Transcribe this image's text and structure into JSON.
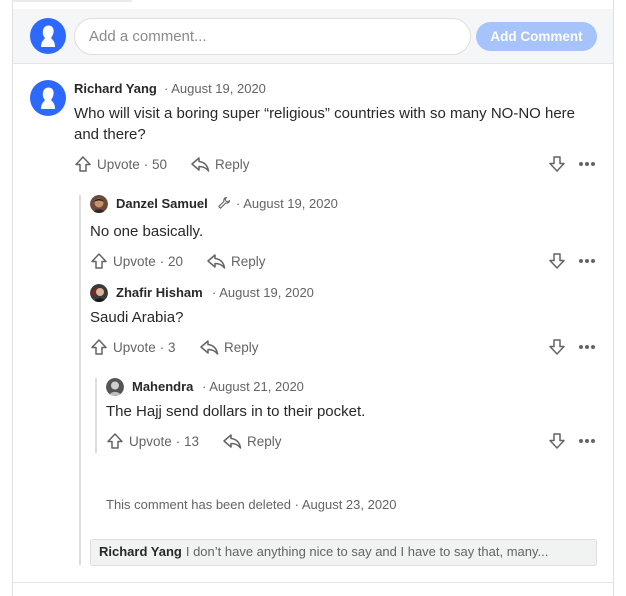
{
  "composer": {
    "placeholder": "Add a comment...",
    "button_label": "Add Comment"
  },
  "comments": [
    {
      "author": "Richard Yang",
      "date": "· August 19, 2020",
      "text": "Who will visit a boring super “religious” countries with so many NO-NO here and there?",
      "upvote_label": "Upvote",
      "upvotes": "· 50",
      "reply_label": "Reply"
    },
    {
      "author": "Danzel Samuel",
      "date": "· August 19, 2020",
      "text": "No one basically.",
      "upvote_label": "Upvote",
      "upvotes": "· 20",
      "reply_label": "Reply"
    },
    {
      "author": "Zhafir Hisham",
      "date": "· August 19, 2020",
      "text": "Saudi Arabia?",
      "upvote_label": "Upvote",
      "upvotes": "· 3",
      "reply_label": "Reply"
    },
    {
      "author": "Mahendra",
      "date": "· August 21, 2020",
      "text": "The Hajj send dollars in to their pocket.",
      "upvote_label": "Upvote",
      "upvotes": "· 13",
      "reply_label": "Reply"
    }
  ],
  "deleted": {
    "text": "This comment has been deleted · August 23, 2020"
  },
  "collapsed": {
    "author": "Richard Yang",
    "preview": "I don’t have anything nice to say and I have to say that, many..."
  },
  "colors": {
    "accent_button": "#a7c3fb",
    "avatar_blue": "#2e69ff"
  }
}
